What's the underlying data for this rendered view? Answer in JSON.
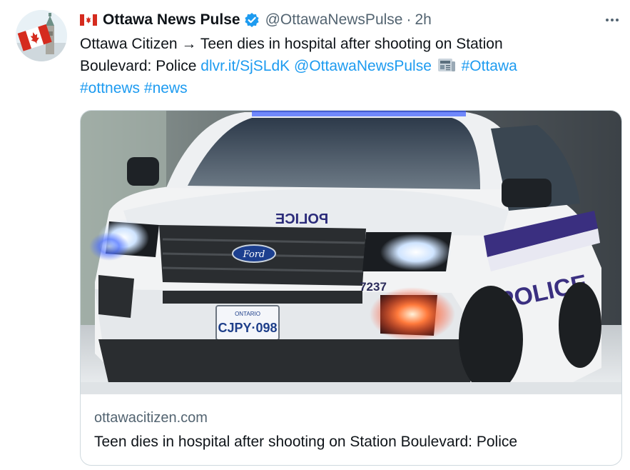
{
  "tweet": {
    "author": {
      "display_name": "Ottawa News Pulse",
      "handle": "@OttawaNewsPulse",
      "separator": "·",
      "time": "2h",
      "flag_icon": "canada-flag-icon",
      "verified_icon": "verified-badge-icon",
      "avatar": "parliament-canada-flag-avatar"
    },
    "text": {
      "line1": "Ottawa Citizen → Teen dies in hospital after shooting on Station",
      "line2_plain": "Boulevard: Police ",
      "short_link": "dlvr.it/SjSLdK",
      "mention": "@OttawaNewsPulse",
      "emoji_icon": "newspaper-icon",
      "hashtags": [
        "#Ottawa",
        "#ottnews",
        "#news"
      ]
    },
    "card": {
      "image_text": {
        "hood_label": "POLICE",
        "side_label": "POLICE",
        "unit_number": "7237",
        "plate_province": "ONTARIO",
        "plate_number": "CJPY·098",
        "grille_badge": "Ford"
      },
      "domain": "ottawacitizen.com",
      "title": "Teen dies in hospital after shooting on Station Boulevard: Police"
    },
    "more_icon": "more-options-icon"
  },
  "colors": {
    "link": "#1d9bf0",
    "secondary_text": "#536471",
    "primary_text": "#0f1419",
    "border": "#cfd9de",
    "verified": "#1d9bf0"
  }
}
